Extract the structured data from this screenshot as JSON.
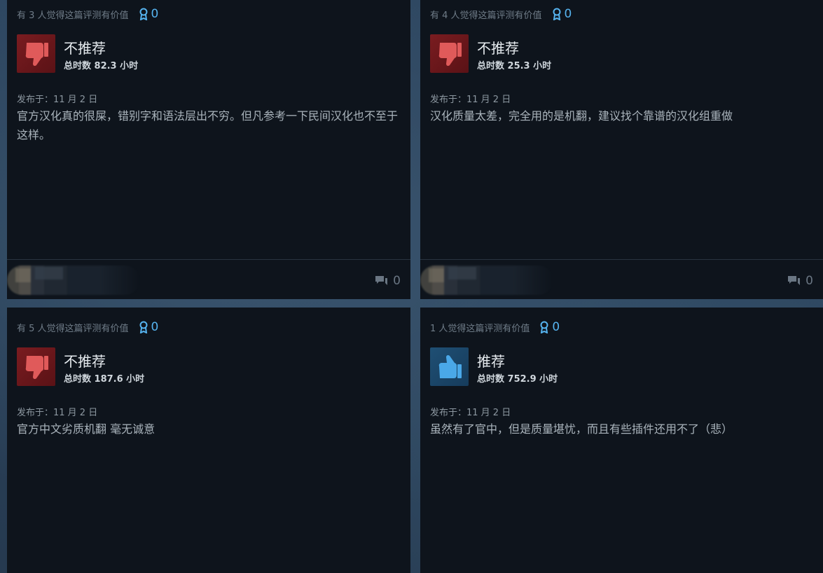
{
  "reviews": [
    {
      "helpful": "有 3 人觉得这篇评测有价值",
      "awards": "0",
      "verdict": "不推荐",
      "hours": "总时数 82.3 小时",
      "posted": "发布于：11 月 2 日",
      "text": "官方汉化真的很屎，错别字和语法层出不穷。但凡参考一下民间汉化也不至于这样。",
      "comments": "0",
      "recommended": false
    },
    {
      "helpful": "有 4 人觉得这篇评测有价值",
      "awards": "0",
      "verdict": "不推荐",
      "hours": "总时数 25.3 小时",
      "posted": "发布于：11 月 2 日",
      "text": "汉化质量太差，完全用的是机翻，建议找个靠谱的汉化组重做",
      "comments": "0",
      "recommended": false
    },
    {
      "helpful": "有 5 人觉得这篇评测有价值",
      "awards": "0",
      "verdict": "不推荐",
      "hours": "总时数 187.6 小时",
      "posted": "发布于：11 月 2 日",
      "text": "官方中文劣质机翻 毫无诚意",
      "recommended": false
    },
    {
      "helpful": "1 人觉得这篇评测有价值",
      "awards": "0",
      "verdict": "推荐",
      "hours": "总时数 752.9 小时",
      "posted": "发布于：11 月 2 日",
      "text": "虽然有了官中，但是质量堪忧，而且有些插件还用不了（悲）",
      "recommended": true
    }
  ],
  "icons": {
    "thumbs_down": "thumbs-down-icon",
    "thumbs_up": "thumbs-up-icon",
    "award": "award-icon",
    "comment": "comment-icon"
  },
  "colors": {
    "card_bg": "#0e141c",
    "award_blue": "#56b4f0",
    "thumb_down_red": "#e05a5a",
    "thumb_up_blue": "#4aa8e8"
  }
}
